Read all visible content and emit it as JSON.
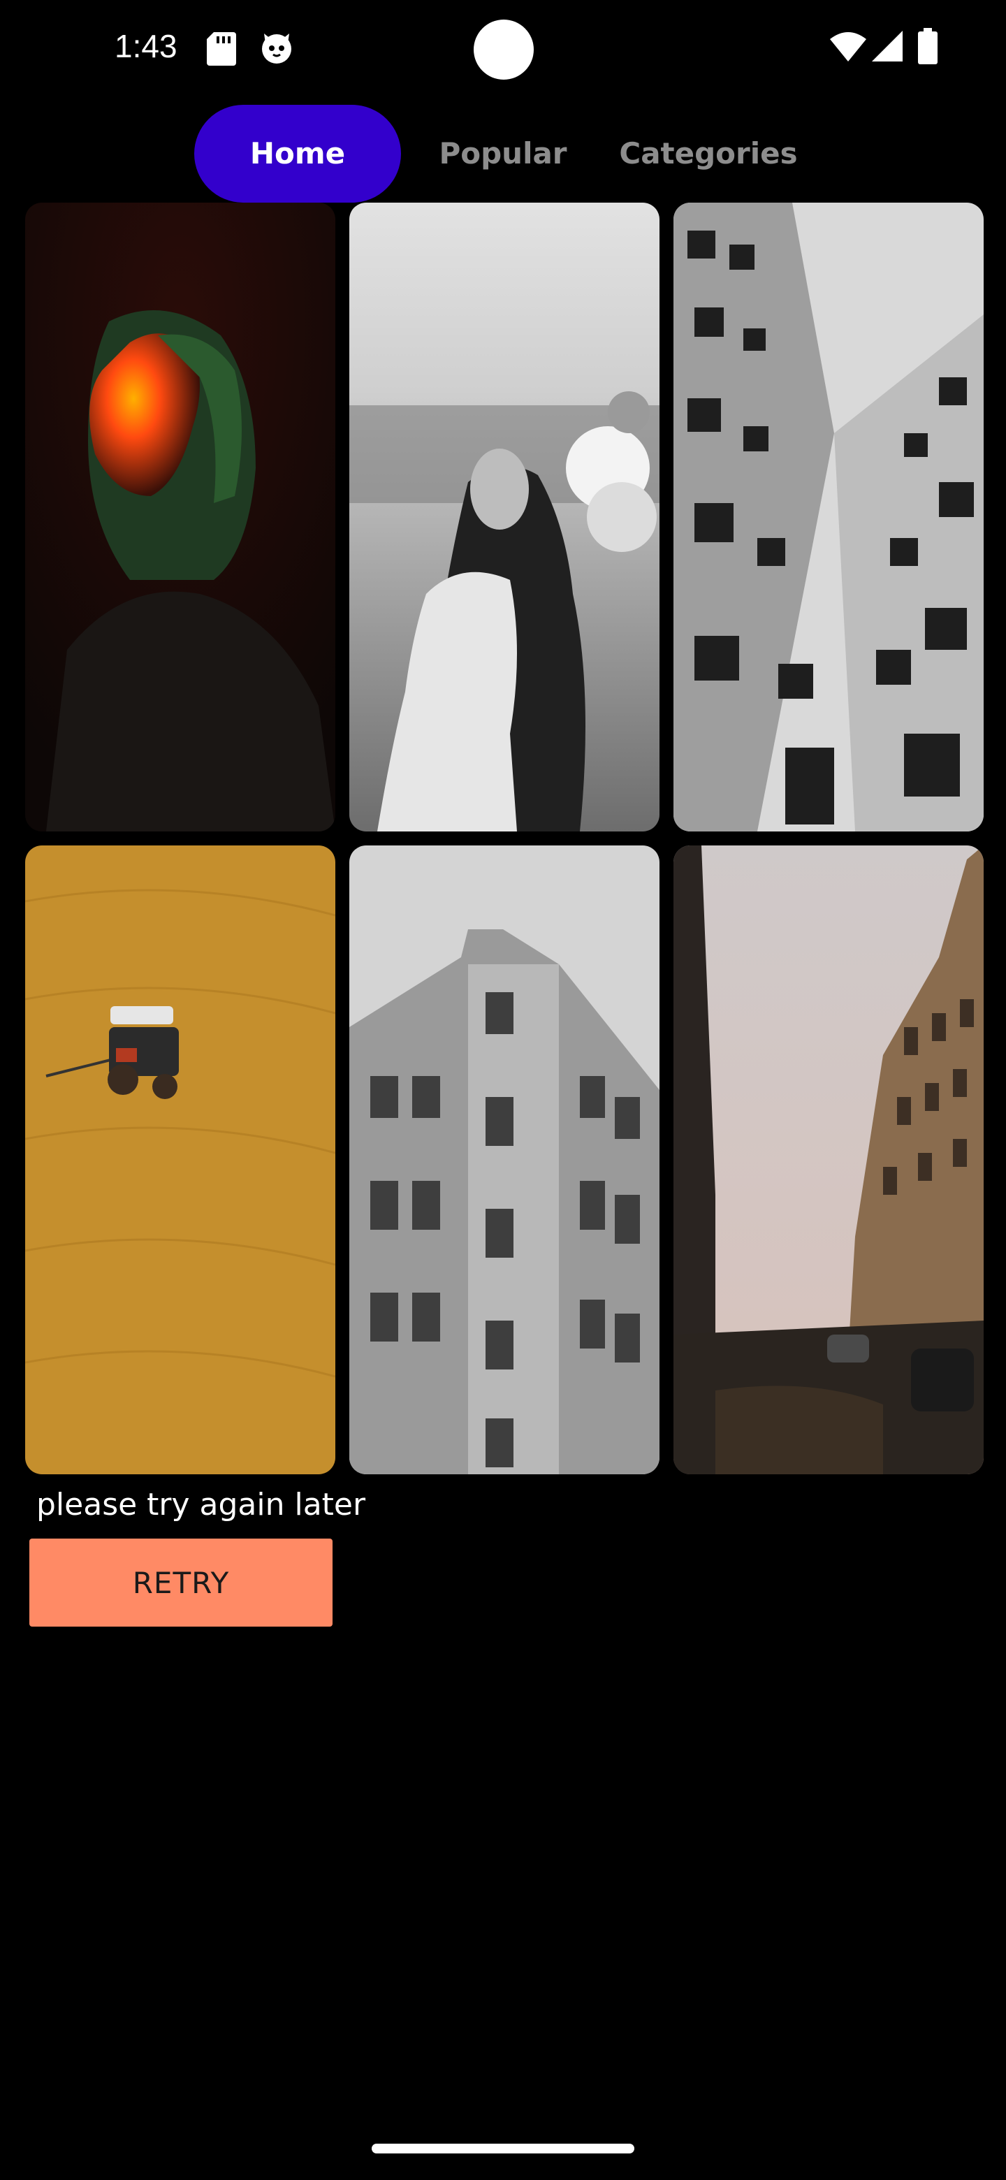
{
  "status_bar": {
    "time": "1:43",
    "icons": [
      "sd-card-icon",
      "cat-face-icon",
      "wifi-icon",
      "signal-icon",
      "battery-icon"
    ]
  },
  "tabs": [
    {
      "label": "Home",
      "active": true
    },
    {
      "label": "Popular",
      "active": false
    },
    {
      "label": "Categories",
      "active": false
    }
  ],
  "colors": {
    "background": "#000000",
    "active_tab": "#3300cc",
    "inactive_tab_text": "#8d8d8d",
    "retry_button": "#ff8a65"
  },
  "wallpapers": [
    {
      "name": "woman-red-light-portrait"
    },
    {
      "name": "woman-with-flowers-bw"
    },
    {
      "name": "building-facade-perspective"
    },
    {
      "name": "tractor-on-sand-field"
    },
    {
      "name": "ornate-building-bw"
    },
    {
      "name": "city-street-at-dusk"
    }
  ],
  "error": {
    "message": "please try again later",
    "retry_label": "RETRY"
  }
}
